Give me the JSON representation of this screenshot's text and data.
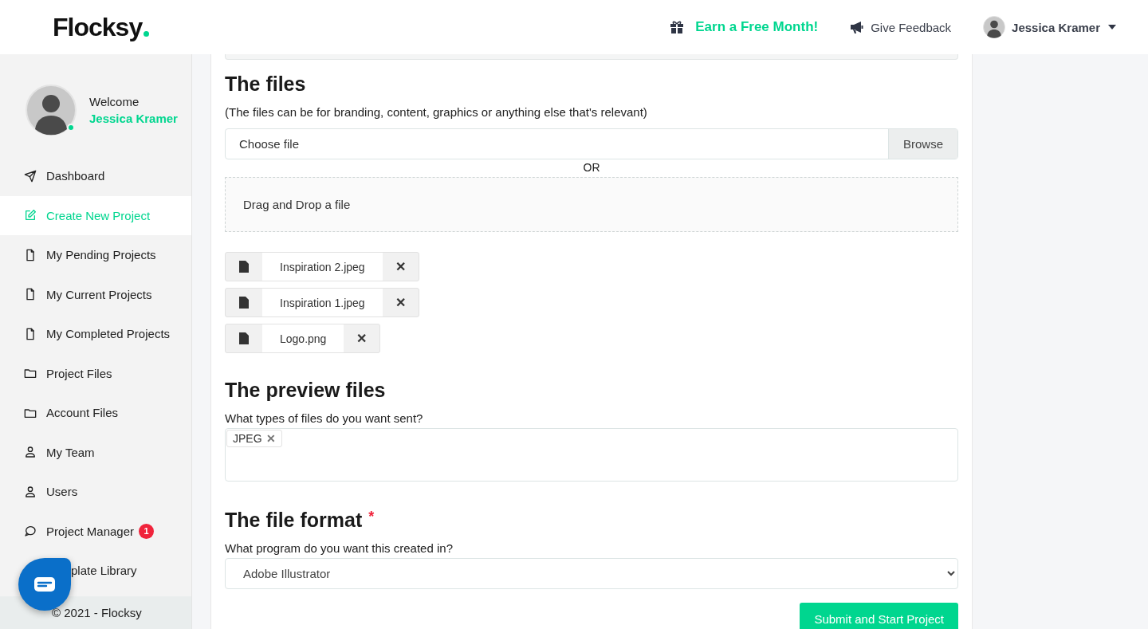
{
  "header": {
    "logo": "Flocksy",
    "promo": "Earn a Free Month!",
    "feedback": "Give Feedback",
    "user": "Jessica Kramer"
  },
  "sidebar": {
    "welcome": "Welcome",
    "name": "Jessica Kramer",
    "online": true,
    "items": [
      {
        "label": "Dashboard",
        "selected": false
      },
      {
        "label": "Create New Project",
        "selected": true
      },
      {
        "label": "My Pending Projects",
        "selected": false
      },
      {
        "label": "My Current Projects",
        "selected": false
      },
      {
        "label": "My Completed Projects",
        "selected": false
      },
      {
        "label": "Project Files",
        "selected": false
      },
      {
        "label": "Account Files",
        "selected": false
      },
      {
        "label": "My Team",
        "selected": false
      },
      {
        "label": "Users",
        "selected": false
      },
      {
        "label": "Project Manager",
        "selected": false,
        "badge": "1"
      },
      {
        "label": "plate Library",
        "selected": false
      }
    ],
    "footer": "© 2021 - Flocksy"
  },
  "files_section": {
    "title": "The files",
    "hint": "(The files can be for branding, content, graphics or anything else that's relevant)",
    "file_input": {
      "placeholder": "Choose file",
      "button": "Browse"
    },
    "or": "OR",
    "dropzone": "Drag and Drop a file",
    "uploads": [
      {
        "name": "Inspiration 2.jpeg",
        "remove": "✕"
      },
      {
        "name": "Inspiration 1.jpeg",
        "remove": "✕"
      },
      {
        "name": "Logo.png",
        "remove": "✕"
      }
    ]
  },
  "preview_section": {
    "title": "The preview files",
    "label": "What types of files do you want sent?",
    "tags": [
      {
        "label": "JPEG",
        "remove": "✕"
      }
    ]
  },
  "format_section": {
    "title": "The file format",
    "required": "*",
    "label": "What program do you want this created in?",
    "value": "Adobe Illustrator"
  },
  "submit": "Submit and Start Project"
}
